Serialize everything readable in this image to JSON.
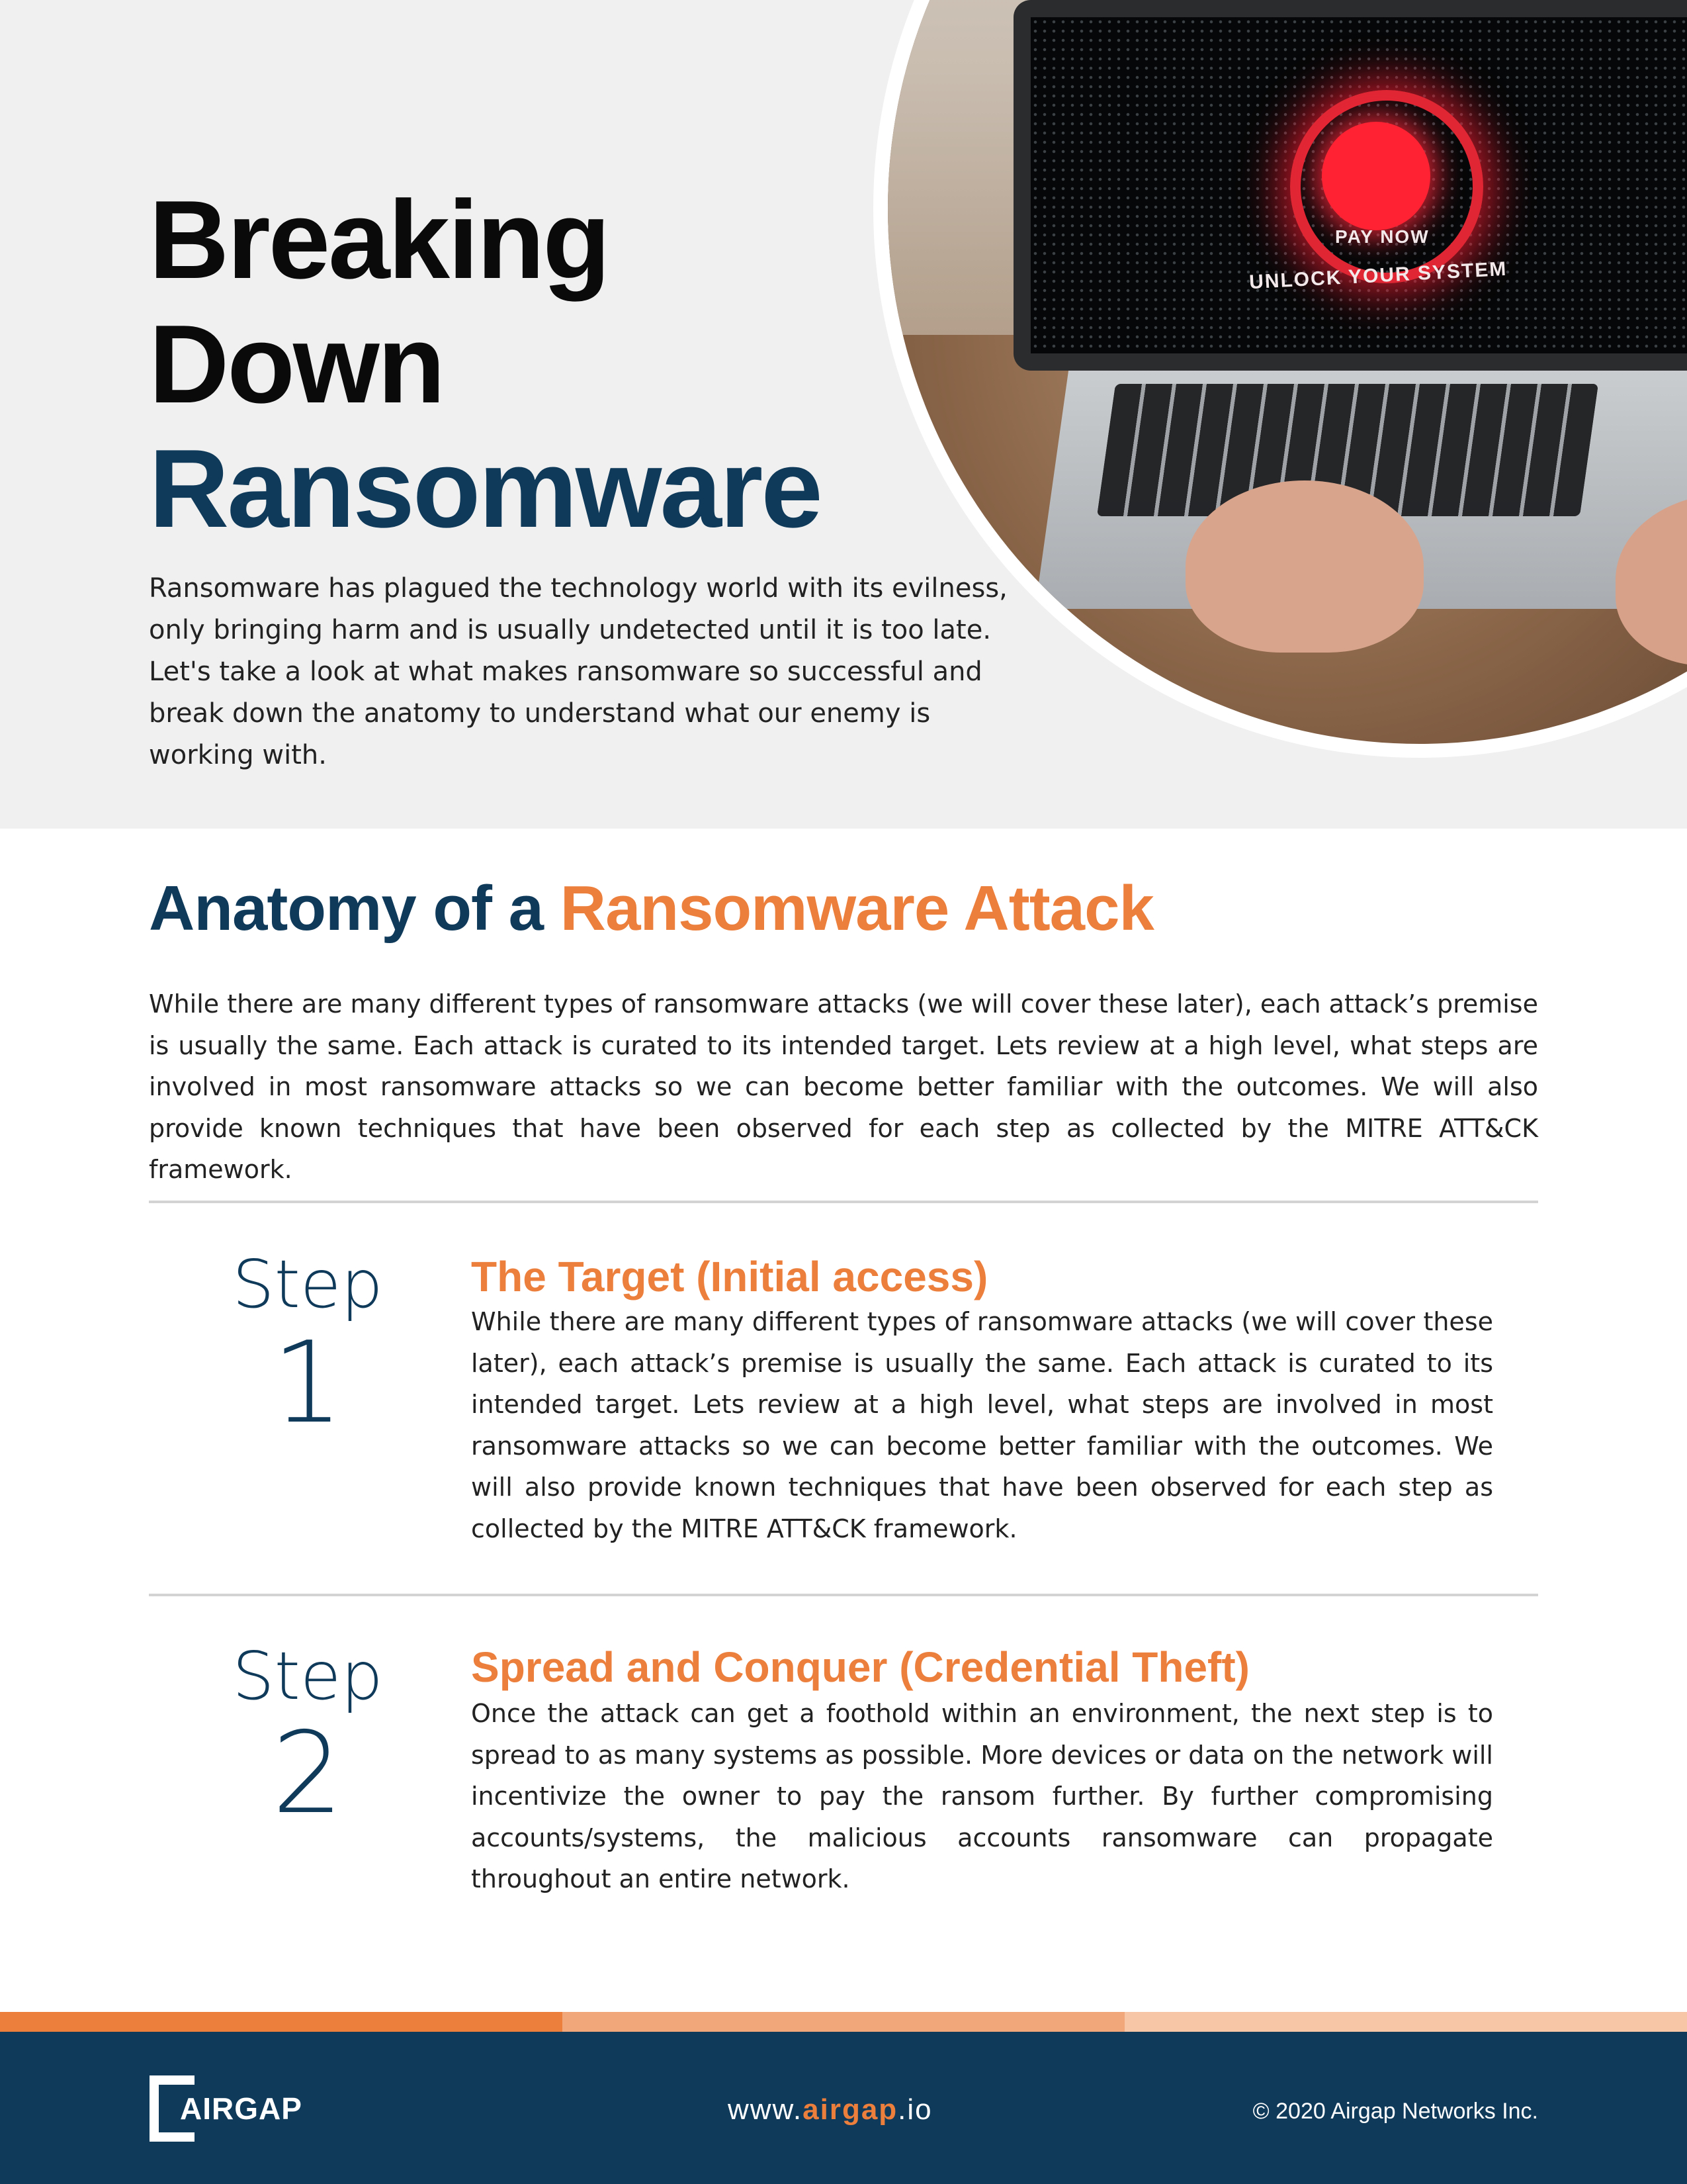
{
  "hero": {
    "title_line1": "Breaking",
    "title_line2": "Down",
    "title_line3": "Ransomware",
    "intro": "Ransomware has plagued the technology world with its evilness, only bringing harm and is usually undetected until it is too late. Let's take a look at what makes ransomware so successful and break down the anatomy to understand what our enemy is working with.",
    "screen_pay": "PAY NOW",
    "screen_unlock": "UNLOCK YOUR SYSTEM"
  },
  "anatomy": {
    "title_part1": "Anatomy of a ",
    "title_part2": "Ransomware Attack",
    "intro": "While there are many different types of ransomware attacks (we will cover these later), each attack’s premise is usually the same. Each attack is curated to its intended target. Lets review at a high level, what steps are involved in most ransomware attacks so we can become better familiar with the outcomes. We will also provide known techniques that have been observed for each step as collected by the MITRE ATT&CK framework."
  },
  "steps": [
    {
      "word": "Step",
      "number": "1",
      "title": "The Target (Initial access)",
      "body": "While there are many different types of ransomware attacks (we will cover these later), each attack’s premise is usually the same. Each attack is curated to its intended target. Lets review at a high level, what steps are involved in most ransomware attacks so we can become better familiar with the outcomes. We will also provide known techniques that have been observed for each step as collected by the MITRE ATT&CK framework."
    },
    {
      "word": "Step",
      "number": "2",
      "title": "Spread and Conquer (Credential Theft)",
      "body": "Once the attack can get a foothold within an environment, the next step is to spread to as many systems as possible. More devices or data on the network will incentivize the owner to pay the ransom further. By further compromising accounts/systems, the malicious accounts ransomware can propagate throughout an entire network."
    }
  ],
  "footer": {
    "logo_text": "AIRGAP",
    "site_prefix": "www.",
    "site_domain": "airgap",
    "site_suffix": ".io",
    "copyright": "© 2020 Airgap Networks Inc."
  },
  "colors": {
    "navy": "#0f3a5a",
    "orange": "#ec7f3c",
    "stripe_1": "#ec7f3c",
    "stripe_2": "#f2a77b",
    "stripe_3": "#f6c6a6",
    "hero_bg": "#f0f0f0"
  }
}
